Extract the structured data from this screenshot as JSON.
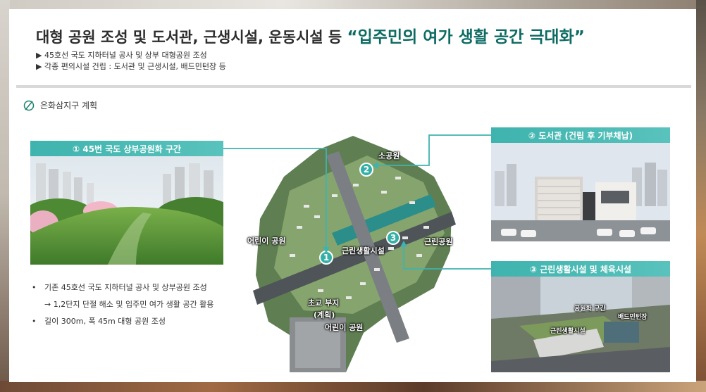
{
  "title": {
    "main": "대형 공원 조성 및 도서관, 근생시설, 운동시설 등 ",
    "highlight": "“입주민의 여가 생활 공간 극대화”"
  },
  "subtitles": [
    "▶ 45호선 국도 지하터널 공사 및 상부 대형공원 조성",
    "▶ 각종 편의시설 건립 : 도서관 및 근생시설, 배드민턴장 등"
  ],
  "plan_label": "은화삼지구 계획",
  "cards": [
    {
      "label": "① 45번 국도 상부공원화 구간"
    },
    {
      "label": "② 도서관 (건립 후 기부채납)"
    },
    {
      "label": "③ 근린생활시설 및 체육시설"
    }
  ],
  "bullets": [
    {
      "marker": "•",
      "text": "기존 45호선 국도 지하터널 공사 및 상부공원 조성"
    },
    {
      "marker": "",
      "text": "→ 1,2단지 단절 해소 및 입주민 여가 생활 공간 활용"
    },
    {
      "marker": "•",
      "text": "길이 300m, 폭 45m 대형 공원 조성"
    }
  ],
  "map_labels": {
    "park_small": "소공원",
    "kids_park_1": "어린이 공원",
    "neighborhood_park": "근린공원",
    "neighborhood_facility": "근린생활시설",
    "school_site": "초교 부지",
    "school_plan": "(계획)",
    "kids_park_2": "어린이 공원"
  },
  "map_numbers": [
    "1",
    "2",
    "3"
  ],
  "facility_labels": {
    "park_area": "공원화 구간",
    "badminton": "배드민턴장",
    "neighborhood": "근린생활시설"
  },
  "colors": {
    "accent": "#0d6b63",
    "header": "#3fb3ae"
  }
}
